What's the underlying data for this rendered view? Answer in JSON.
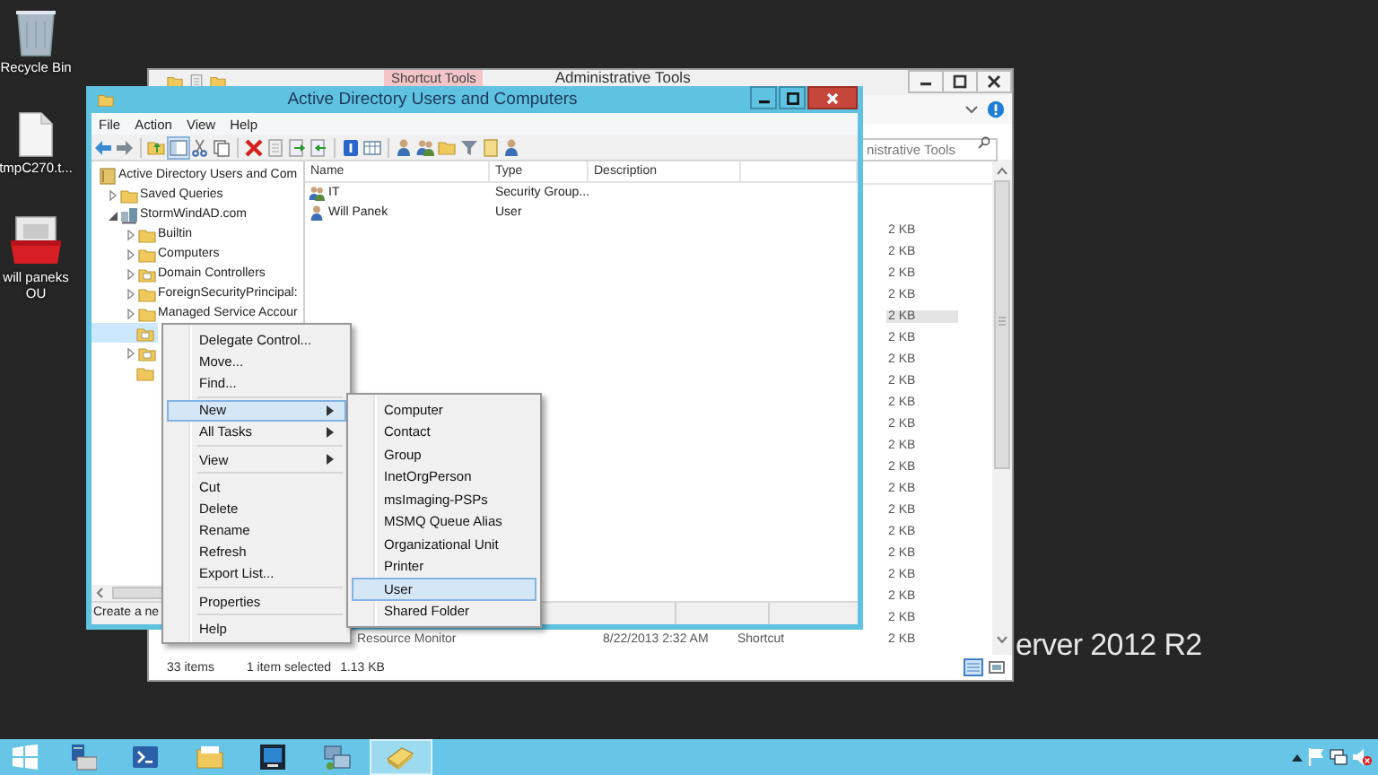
{
  "desktop_icons": [
    {
      "label": "Recycle Bin"
    },
    {
      "label": "tmpC270.t..."
    },
    {
      "label": "will paneks OU"
    }
  ],
  "desktop_text": "erver 2012 R2",
  "explorer": {
    "title": "Administrative Tools",
    "ribbon_tab": "Shortcut Tools",
    "search": {
      "placeholder": "nistrative Tools"
    },
    "rows": [
      {
        "size": "2 KB",
        "selected": false
      },
      {
        "size": "2 KB",
        "selected": false
      },
      {
        "size": "2 KB",
        "selected": false
      },
      {
        "size": "2 KB",
        "selected": false
      },
      {
        "size": "2 KB",
        "selected": true
      },
      {
        "size": "2 KB",
        "selected": false
      },
      {
        "size": "2 KB",
        "selected": false
      },
      {
        "size": "2 KB",
        "selected": false
      },
      {
        "size": "2 KB",
        "selected": false
      },
      {
        "size": "2 KB",
        "selected": false
      },
      {
        "size": "2 KB",
        "selected": false
      },
      {
        "size": "2 KB",
        "selected": false
      },
      {
        "size": "2 KB",
        "selected": false
      },
      {
        "size": "2 KB",
        "selected": false
      },
      {
        "size": "2 KB",
        "selected": false
      },
      {
        "size": "2 KB",
        "selected": false
      },
      {
        "size": "2 KB",
        "selected": false
      },
      {
        "size": "2 KB",
        "selected": false
      },
      {
        "size": "2 KB",
        "selected": false
      },
      {
        "name": "Resource Monitor",
        "date": "8/22/2013 2:32 AM",
        "type": "Shortcut",
        "size": "2 KB",
        "selected": false
      }
    ],
    "status": {
      "count": "33 items",
      "selection": "1 item selected",
      "size": "1.13 KB"
    }
  },
  "aduc": {
    "title": "Active Directory Users and Computers",
    "menu": [
      "File",
      "Action",
      "View",
      "Help"
    ],
    "toolbar": [
      {
        "kind": "back"
      },
      {
        "kind": "forward"
      },
      {
        "kind": "separator"
      },
      {
        "kind": "up"
      },
      {
        "kind": "tree",
        "pressed": true
      },
      {
        "kind": "cut"
      },
      {
        "kind": "copy"
      },
      {
        "kind": "separator"
      },
      {
        "kind": "delete"
      },
      {
        "kind": "properties"
      },
      {
        "kind": "export"
      },
      {
        "kind": "import"
      },
      {
        "kind": "separator"
      },
      {
        "kind": "help"
      },
      {
        "kind": "table"
      },
      {
        "kind": "separator"
      },
      {
        "kind": "user"
      },
      {
        "kind": "group"
      },
      {
        "kind": "folder"
      },
      {
        "kind": "filter"
      },
      {
        "kind": "document"
      },
      {
        "kind": "user"
      }
    ],
    "tree": [
      {
        "label": "Active Directory Users and Com",
        "kind": "root",
        "selected": false,
        "children": [
          {
            "label": "Saved Queries",
            "kind": "folder",
            "expanded": false,
            "selected": false
          },
          {
            "label": "StormWindAD.com",
            "kind": "domain",
            "expanded": true,
            "selected": false,
            "children": [
              {
                "label": "Builtin",
                "kind": "folder",
                "expanded": false,
                "selected": false
              },
              {
                "label": "Computers",
                "kind": "folder",
                "expanded": false,
                "selected": false
              },
              {
                "label": "Domain Controllers",
                "kind": "ou",
                "expanded": false,
                "selected": false
              },
              {
                "label": "ForeignSecurityPrincipal:",
                "kind": "folder",
                "expanded": false,
                "selected": false
              },
              {
                "label": "Managed Service Accour",
                "kind": "folder",
                "expanded": false,
                "selected": false
              },
              {
                "kind": "ou",
                "selected": true
              },
              {
                "kind": "ou",
                "expanded": false,
                "selected": false
              },
              {
                "kind": "folder",
                "selected": false
              }
            ]
          }
        ]
      }
    ],
    "columns": [
      "Name",
      "Type",
      "Description"
    ],
    "rows": [
      {
        "name": "IT",
        "type": "Security Group...",
        "kind": "group",
        "selected": false
      },
      {
        "name": "Will Panek",
        "type": "User",
        "kind": "user",
        "selected": false
      }
    ],
    "status": "Create a ne"
  },
  "context_menu": [
    {
      "kind": "item",
      "label": "Delegate Control...",
      "submenu": false,
      "selected": false
    },
    {
      "kind": "item",
      "label": "Move...",
      "submenu": false,
      "selected": false
    },
    {
      "kind": "item",
      "label": "Find...",
      "submenu": false,
      "selected": false
    },
    {
      "kind": "separator"
    },
    {
      "kind": "item",
      "label": "New",
      "submenu": true,
      "selected": true
    },
    {
      "kind": "item",
      "label": "All Tasks",
      "submenu": true,
      "selected": false
    },
    {
      "kind": "separator"
    },
    {
      "kind": "item",
      "label": "View",
      "submenu": true,
      "selected": false
    },
    {
      "kind": "separator"
    },
    {
      "kind": "item",
      "label": "Cut",
      "submenu": false,
      "selected": false
    },
    {
      "kind": "item",
      "label": "Delete",
      "submenu": false,
      "selected": false
    },
    {
      "kind": "item",
      "label": "Rename",
      "submenu": false,
      "selected": false
    },
    {
      "kind": "item",
      "label": "Refresh",
      "submenu": false,
      "selected": false
    },
    {
      "kind": "item",
      "label": "Export List...",
      "submenu": false,
      "selected": false
    },
    {
      "kind": "separator"
    },
    {
      "kind": "item",
      "label": "Properties",
      "submenu": false,
      "selected": false
    },
    {
      "kind": "separator"
    },
    {
      "kind": "item",
      "label": "Help",
      "submenu": false,
      "selected": false
    }
  ],
  "submenu": [
    {
      "label": "Computer",
      "selected": false
    },
    {
      "label": "Contact",
      "selected": false
    },
    {
      "label": "Group",
      "selected": false
    },
    {
      "label": "InetOrgPerson",
      "selected": false
    },
    {
      "label": "msImaging-PSPs",
      "selected": false
    },
    {
      "label": "MSMQ Queue Alias",
      "selected": false
    },
    {
      "label": "Organizational Unit",
      "selected": false
    },
    {
      "label": "Printer",
      "selected": false
    },
    {
      "label": "User",
      "selected": true
    },
    {
      "label": "Shared Folder",
      "selected": false
    }
  ],
  "taskbar": {
    "apps": [
      {
        "selected": false
      },
      {
        "selected": false
      },
      {
        "selected": false
      },
      {
        "selected": false
      },
      {
        "selected": false
      },
      {
        "selected": true
      }
    ]
  }
}
